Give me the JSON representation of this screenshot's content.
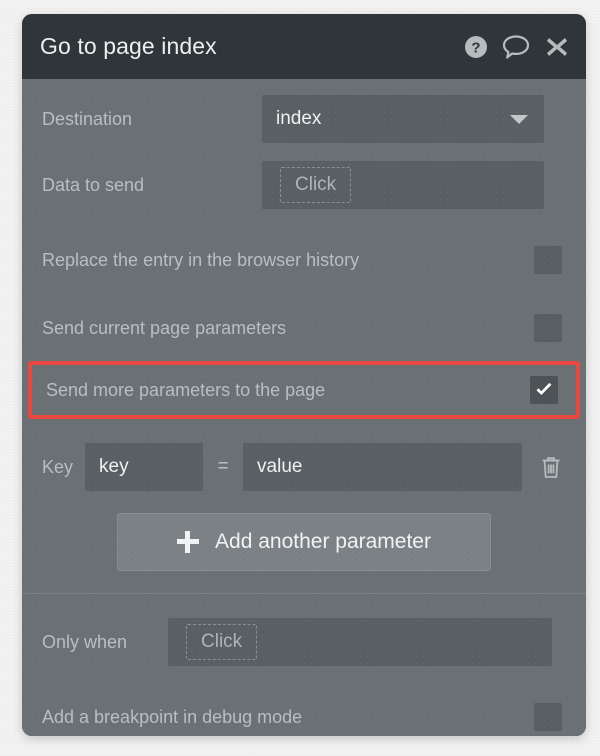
{
  "window": {
    "title": "Go to page index",
    "icons": {
      "help": "help-circle-icon",
      "comment": "comment-bubble-icon",
      "close": "close-icon"
    }
  },
  "form": {
    "destination": {
      "label": "Destination",
      "value": "index"
    },
    "data_to_send": {
      "label": "Data to send",
      "placeholder": "Click"
    },
    "replace_history": {
      "label": "Replace the entry in the browser history",
      "checked": false
    },
    "send_current_params": {
      "label": "Send current page parameters",
      "checked": false
    },
    "send_more_params": {
      "label": "Send more parameters to the page",
      "checked": true,
      "highlight_color": "#e8483f"
    },
    "parameters": [
      {
        "key_label": "Key",
        "key_value": "key",
        "equals": "=",
        "value_value": "value",
        "delete_icon": "trash-icon"
      }
    ],
    "add_parameter": {
      "label": "Add another parameter",
      "icon": "plus-icon"
    },
    "only_when": {
      "label": "Only when",
      "placeholder": "Click"
    },
    "breakpoint": {
      "label": "Add a breakpoint in debug mode",
      "checked": false
    }
  },
  "colors": {
    "titlebar": "#2f3538",
    "body": "#6a7074",
    "field": "#595f63",
    "accent_red": "#e8483f",
    "text": "#eceff0",
    "label": "#b9bec1"
  }
}
